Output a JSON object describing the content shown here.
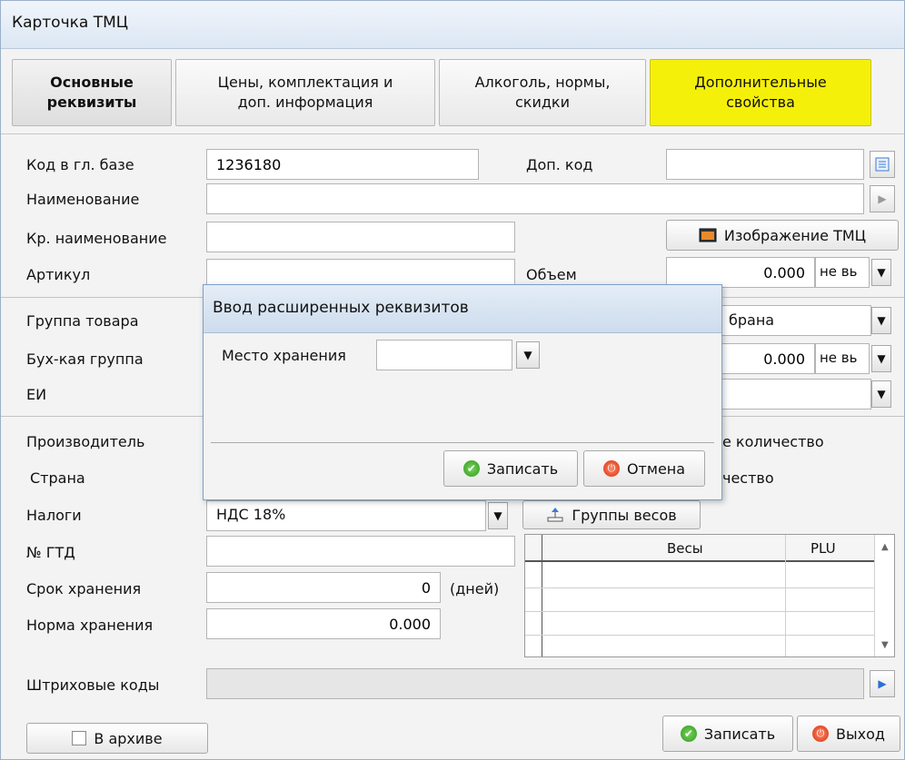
{
  "window": {
    "title": "Карточка ТМЦ"
  },
  "tabs": [
    {
      "line1": "Основные",
      "line2": "реквизиты"
    },
    {
      "line1": "Цены, комплектация и",
      "line2": "доп.  информация"
    },
    {
      "line1": "Алкоголь, нормы,",
      "line2": "скидки"
    },
    {
      "line1": "Дополнительные",
      "line2": "свойства"
    }
  ],
  "form": {
    "code_label": "Код в гл. базе",
    "code_value": "1236180",
    "extra_code_label": "Доп. код",
    "extra_code_value": "",
    "name_label": "Наименование",
    "name_value": "",
    "short_name_label": "Кр. наименование",
    "short_name_value": "",
    "image_button": "Изображение ТМЦ",
    "article_label": "Артикул",
    "article_value": "",
    "volume_label": "Объем",
    "volume_value": "0.000",
    "volume_unit": "не вь",
    "group_label": "Группа товара",
    "group_value": "брана",
    "acc_group_label": "Бух-кая группа",
    "acc_value": "0.000",
    "acc_unit": "не вь",
    "unit_label": "ЕИ",
    "manufacturer_label": "Производитель",
    "qty_text_1": "е количество",
    "country_label": "Страна",
    "qty_text_2": "чество",
    "taxes_label": "Налоги",
    "taxes_value": "НДС 18%",
    "weights_groups_button": "Группы весов",
    "gtd_label": "№ ГТД",
    "gtd_value": "",
    "shelf_life_label": "Срок хранения",
    "shelf_life_value": "0",
    "shelf_life_unit": "(дней)",
    "storage_norm_label": "Норма хранения",
    "storage_norm_value": "0.000",
    "barcodes_label": "Штриховые коды",
    "barcodes_value": ""
  },
  "scales_table": {
    "col_scales": "Весы",
    "col_plu": "PLU"
  },
  "footer": {
    "archive_label": "В архиве",
    "save_button": "Записать",
    "exit_button": "Выход"
  },
  "dialog": {
    "title": "Ввод расширенных реквизитов",
    "storage_place_label": "Место хранения",
    "storage_place_value": "",
    "save_button": "Записать",
    "cancel_button": "Отмена"
  },
  "colors": {
    "highlight_tab": "#f5f00a",
    "title_bar": "#dce7f3"
  }
}
